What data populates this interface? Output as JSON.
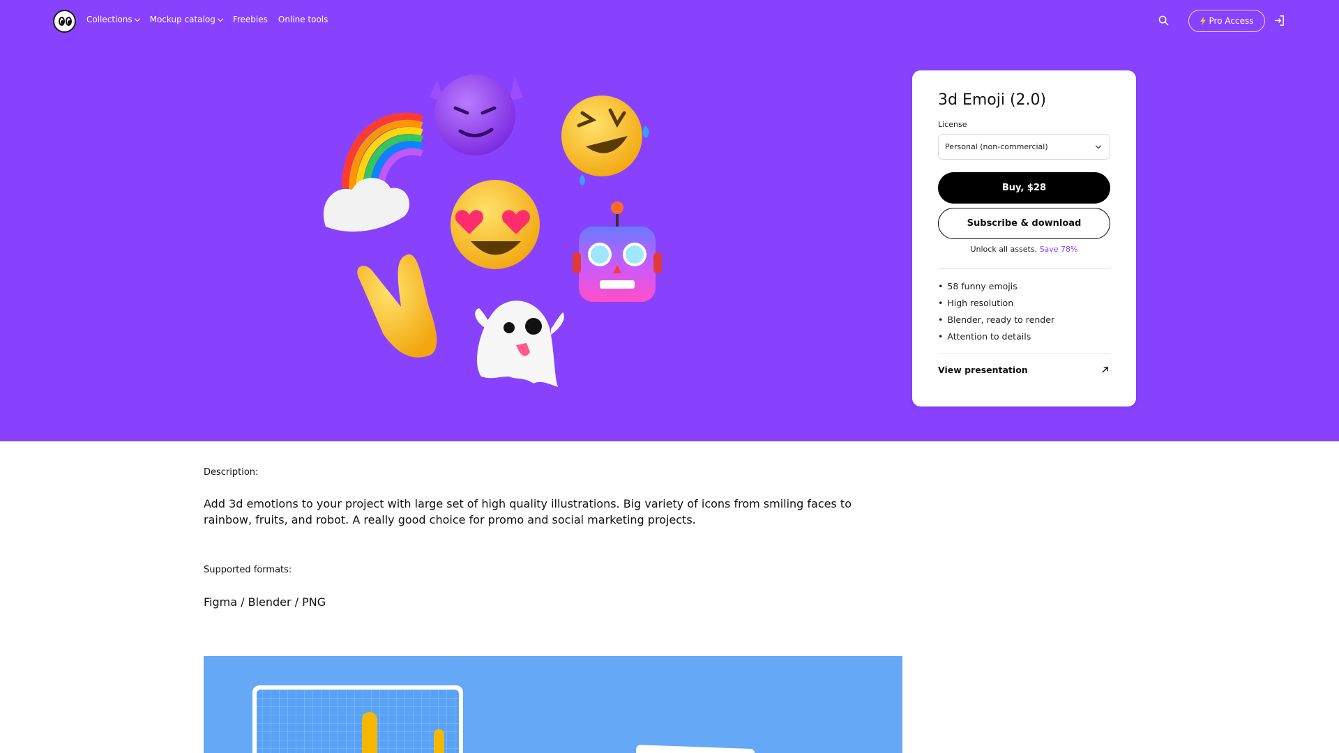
{
  "nav": {
    "links": [
      "Collections",
      "Mockup catalog",
      "Freebies",
      "Online tools"
    ],
    "pro_label": "Pro Access"
  },
  "product": {
    "title": "3d Emoji (2.0)",
    "license_label": "License",
    "license_value": "Personal (non-commercial)",
    "buy_label": "Buy, $28",
    "subscribe_label": "Subscribe & download",
    "unlock_text": "Unlock all assets.",
    "save_text": "Save 78%",
    "features": [
      "58 funny emojis",
      "High resolution",
      "Blender, ready to render",
      "Attention to details"
    ],
    "presentation_label": "View presentation"
  },
  "description": {
    "label": "Description:",
    "text": "Add 3d emotions to your project with large set of high quality illustrations. Big variety of icons from smiling faces to rainbow, fruits, and robot. A really good choice for promo and social marketing projects.",
    "formats_label": "Supported formats:",
    "formats": "Figma / Blender / PNG"
  },
  "colors": {
    "hero_bg": "#8842fe",
    "preview_bg": "#65a8f6",
    "accent": "#8842fe"
  }
}
